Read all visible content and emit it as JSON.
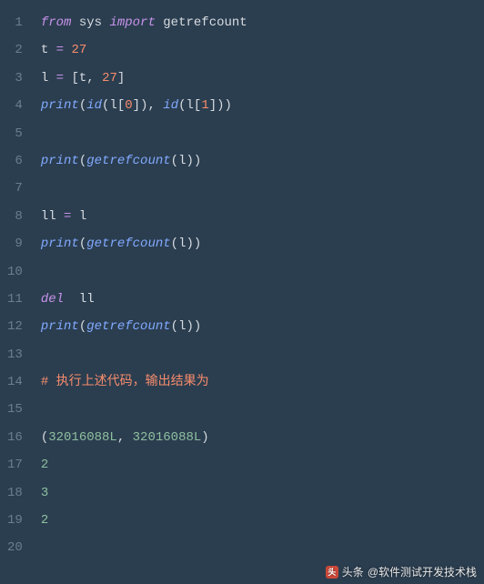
{
  "code": {
    "lines": [
      {
        "n": "1",
        "tokens": [
          {
            "cls": "tok-kw",
            "t": "from"
          },
          {
            "cls": "",
            "t": " "
          },
          {
            "cls": "tok-mod",
            "t": "sys"
          },
          {
            "cls": "",
            "t": " "
          },
          {
            "cls": "tok-kw",
            "t": "import"
          },
          {
            "cls": "",
            "t": " "
          },
          {
            "cls": "tok-name",
            "t": "getrefcount"
          }
        ]
      },
      {
        "n": "2",
        "tokens": [
          {
            "cls": "tok-name",
            "t": "t"
          },
          {
            "cls": "",
            "t": " "
          },
          {
            "cls": "tok-op",
            "t": "="
          },
          {
            "cls": "",
            "t": " "
          },
          {
            "cls": "tok-num",
            "t": "27"
          }
        ]
      },
      {
        "n": "3",
        "tokens": [
          {
            "cls": "tok-name",
            "t": "l"
          },
          {
            "cls": "",
            "t": " "
          },
          {
            "cls": "tok-op",
            "t": "="
          },
          {
            "cls": "",
            "t": " "
          },
          {
            "cls": "tok-punc",
            "t": "["
          },
          {
            "cls": "tok-name",
            "t": "t"
          },
          {
            "cls": "tok-punc",
            "t": ","
          },
          {
            "cls": "",
            "t": " "
          },
          {
            "cls": "tok-num",
            "t": "27"
          },
          {
            "cls": "tok-punc",
            "t": "]"
          }
        ]
      },
      {
        "n": "4",
        "tokens": [
          {
            "cls": "tok-call",
            "t": "print"
          },
          {
            "cls": "tok-punc",
            "t": "("
          },
          {
            "cls": "tok-call",
            "t": "id"
          },
          {
            "cls": "tok-punc",
            "t": "("
          },
          {
            "cls": "tok-name",
            "t": "l"
          },
          {
            "cls": "tok-punc",
            "t": "["
          },
          {
            "cls": "tok-num",
            "t": "0"
          },
          {
            "cls": "tok-punc",
            "t": "])"
          },
          {
            "cls": "tok-punc",
            "t": ","
          },
          {
            "cls": "",
            "t": " "
          },
          {
            "cls": "tok-call",
            "t": "id"
          },
          {
            "cls": "tok-punc",
            "t": "("
          },
          {
            "cls": "tok-name",
            "t": "l"
          },
          {
            "cls": "tok-punc",
            "t": "["
          },
          {
            "cls": "tok-num",
            "t": "1"
          },
          {
            "cls": "tok-punc",
            "t": "]))"
          }
        ]
      },
      {
        "n": "5",
        "tokens": []
      },
      {
        "n": "6",
        "tokens": [
          {
            "cls": "tok-call",
            "t": "print"
          },
          {
            "cls": "tok-punc",
            "t": "("
          },
          {
            "cls": "tok-call",
            "t": "getrefcount"
          },
          {
            "cls": "tok-punc",
            "t": "("
          },
          {
            "cls": "tok-name",
            "t": "l"
          },
          {
            "cls": "tok-punc",
            "t": "))"
          }
        ]
      },
      {
        "n": "7",
        "tokens": []
      },
      {
        "n": "8",
        "tokens": [
          {
            "cls": "tok-name",
            "t": "ll"
          },
          {
            "cls": "",
            "t": " "
          },
          {
            "cls": "tok-op",
            "t": "="
          },
          {
            "cls": "",
            "t": " "
          },
          {
            "cls": "tok-name",
            "t": "l"
          }
        ]
      },
      {
        "n": "9",
        "tokens": [
          {
            "cls": "tok-call",
            "t": "print"
          },
          {
            "cls": "tok-punc",
            "t": "("
          },
          {
            "cls": "tok-call",
            "t": "getrefcount"
          },
          {
            "cls": "tok-punc",
            "t": "("
          },
          {
            "cls": "tok-name",
            "t": "l"
          },
          {
            "cls": "tok-punc",
            "t": "))"
          }
        ]
      },
      {
        "n": "10",
        "tokens": []
      },
      {
        "n": "11",
        "tokens": [
          {
            "cls": "tok-kw",
            "t": "del"
          },
          {
            "cls": "",
            "t": "  "
          },
          {
            "cls": "tok-name",
            "t": "ll"
          }
        ]
      },
      {
        "n": "12",
        "tokens": [
          {
            "cls": "tok-call",
            "t": "print"
          },
          {
            "cls": "tok-punc",
            "t": "("
          },
          {
            "cls": "tok-call",
            "t": "getrefcount"
          },
          {
            "cls": "tok-punc",
            "t": "("
          },
          {
            "cls": "tok-name",
            "t": "l"
          },
          {
            "cls": "tok-punc",
            "t": "))"
          }
        ]
      },
      {
        "n": "13",
        "tokens": []
      },
      {
        "n": "14",
        "tokens": [
          {
            "cls": "tok-comment",
            "t": "# 执行上述代码，输出结果为"
          }
        ]
      },
      {
        "n": "15",
        "tokens": []
      },
      {
        "n": "16",
        "tokens": [
          {
            "cls": "tok-punc",
            "t": "("
          },
          {
            "cls": "tok-out",
            "t": "32016088L"
          },
          {
            "cls": "tok-punc",
            "t": ","
          },
          {
            "cls": "",
            "t": " "
          },
          {
            "cls": "tok-out",
            "t": "32016088L"
          },
          {
            "cls": "tok-punc",
            "t": ")"
          }
        ]
      },
      {
        "n": "17",
        "tokens": [
          {
            "cls": "tok-out",
            "t": "2"
          }
        ]
      },
      {
        "n": "18",
        "tokens": [
          {
            "cls": "tok-out",
            "t": "3"
          }
        ]
      },
      {
        "n": "19",
        "tokens": [
          {
            "cls": "tok-out",
            "t": "2"
          }
        ]
      },
      {
        "n": "20",
        "tokens": []
      }
    ]
  },
  "watermark": {
    "prefix": "头条",
    "handle": "@软件测试开发技术栈"
  }
}
